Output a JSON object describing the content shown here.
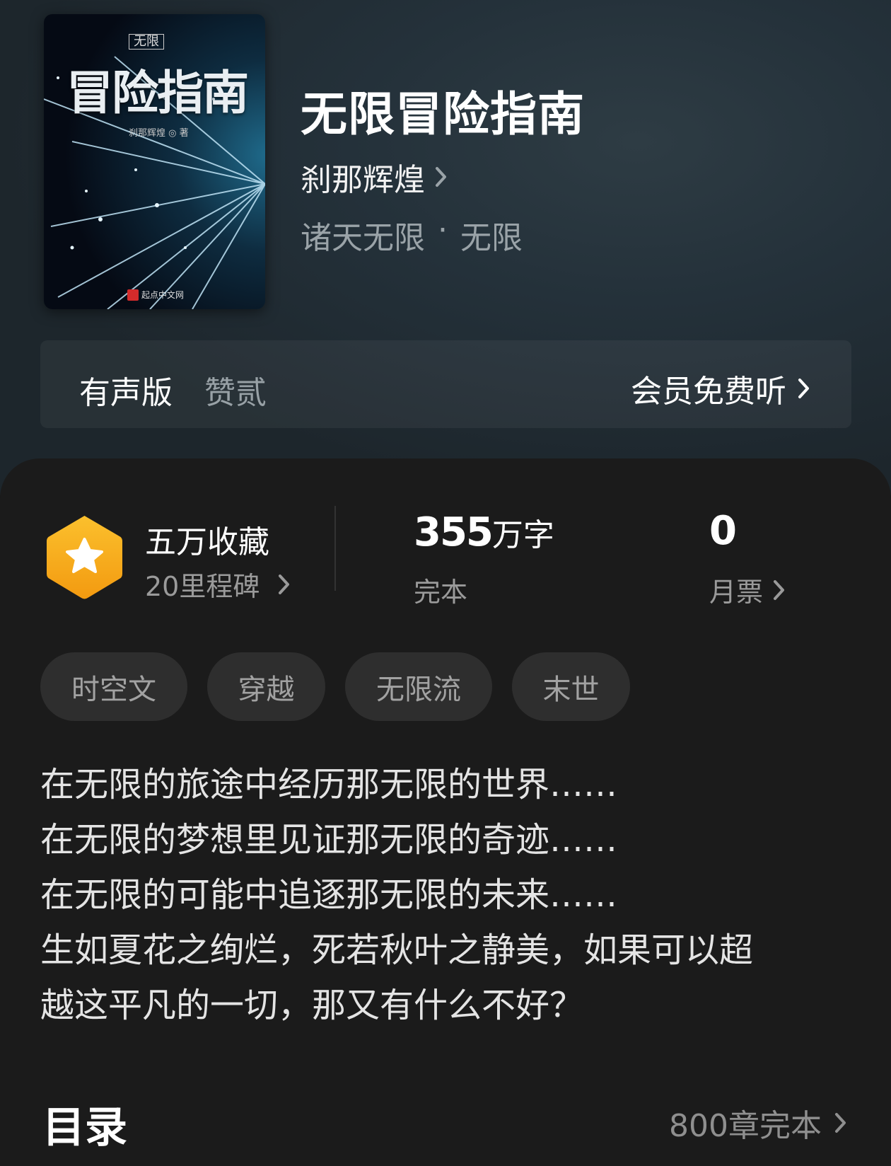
{
  "book": {
    "title": "无限冒险指南",
    "author": "刹那辉煌",
    "genre": "诸天无限",
    "subgenre": "无限",
    "separator": "·"
  },
  "cover": {
    "tag": "无限",
    "title": "冒险指南",
    "author_line": "刹那辉煌 ◎ 著",
    "publisher": "起点中文网"
  },
  "audio": {
    "label": "有声版",
    "narrator": "赞贰",
    "action": "会员免费听"
  },
  "stats": {
    "favorites_title": "五万收藏",
    "milestones": "20里程碑",
    "word_count": "355",
    "word_unit": "万字",
    "status": "完本",
    "monthly_votes": "0",
    "monthly_votes_label": "月票"
  },
  "tags": [
    "时空文",
    "穿越",
    "无限流",
    "末世"
  ],
  "intro": [
    "在无限的旅途中经历那无限的世界……",
    "在无限的梦想里见证那无限的奇迹……",
    "在无限的可能中追逐那无限的未来……",
    "生如夏花之绚烂，死若秋叶之静美，如果可以超",
    "越这平凡的一切，那又有什么不好？"
  ],
  "toc": {
    "title": "目录",
    "info": "800章完本"
  },
  "colors": {
    "badge_orange": "#f7a817",
    "panel_bg": "#1b1b1b",
    "tag_bg": "#2e2e2e"
  },
  "icons": [
    "chevron-right-icon",
    "star-badge-icon"
  ]
}
